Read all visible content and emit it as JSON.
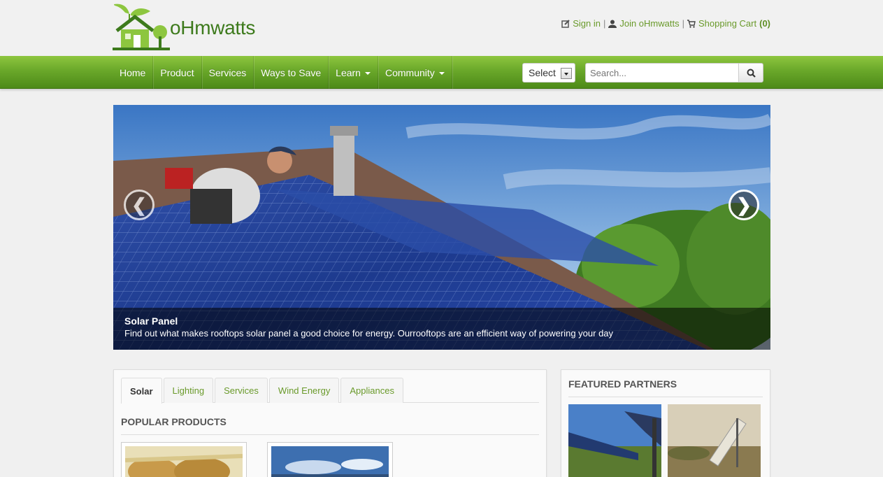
{
  "brand": {
    "name": "oHmwatts"
  },
  "toplinks": {
    "sign_in": "Sign in",
    "join": "Join oHmwatts",
    "cart": "Shopping Cart",
    "cart_count": "(0)",
    "separator": "|"
  },
  "nav": {
    "items": [
      {
        "label": "Home"
      },
      {
        "label": "Product"
      },
      {
        "label": "Services"
      },
      {
        "label": "Ways to Save"
      },
      {
        "label": "Learn"
      },
      {
        "label": "Community"
      }
    ],
    "select_label": "Select",
    "search_placeholder": "Search..."
  },
  "hero": {
    "title": "Solar Panel",
    "text": "Find out what makes rooftops solar panel a good choice for energy. Ourrooftops are an efficient way of powering your day",
    "prev": "❮",
    "next": "❯"
  },
  "tabs": [
    {
      "label": "Solar"
    },
    {
      "label": "Lighting"
    },
    {
      "label": "Services"
    },
    {
      "label": "Wind Energy"
    },
    {
      "label": "Appliances"
    }
  ],
  "popular_products": {
    "title": "POPULAR PRODUCTS"
  },
  "featured_partners": {
    "title": "FEATURED PARTNERS"
  },
  "colors": {
    "brand_green": "#3d7a1c",
    "nav_green": "#6aa82a",
    "link_green": "#6a9a2b"
  }
}
